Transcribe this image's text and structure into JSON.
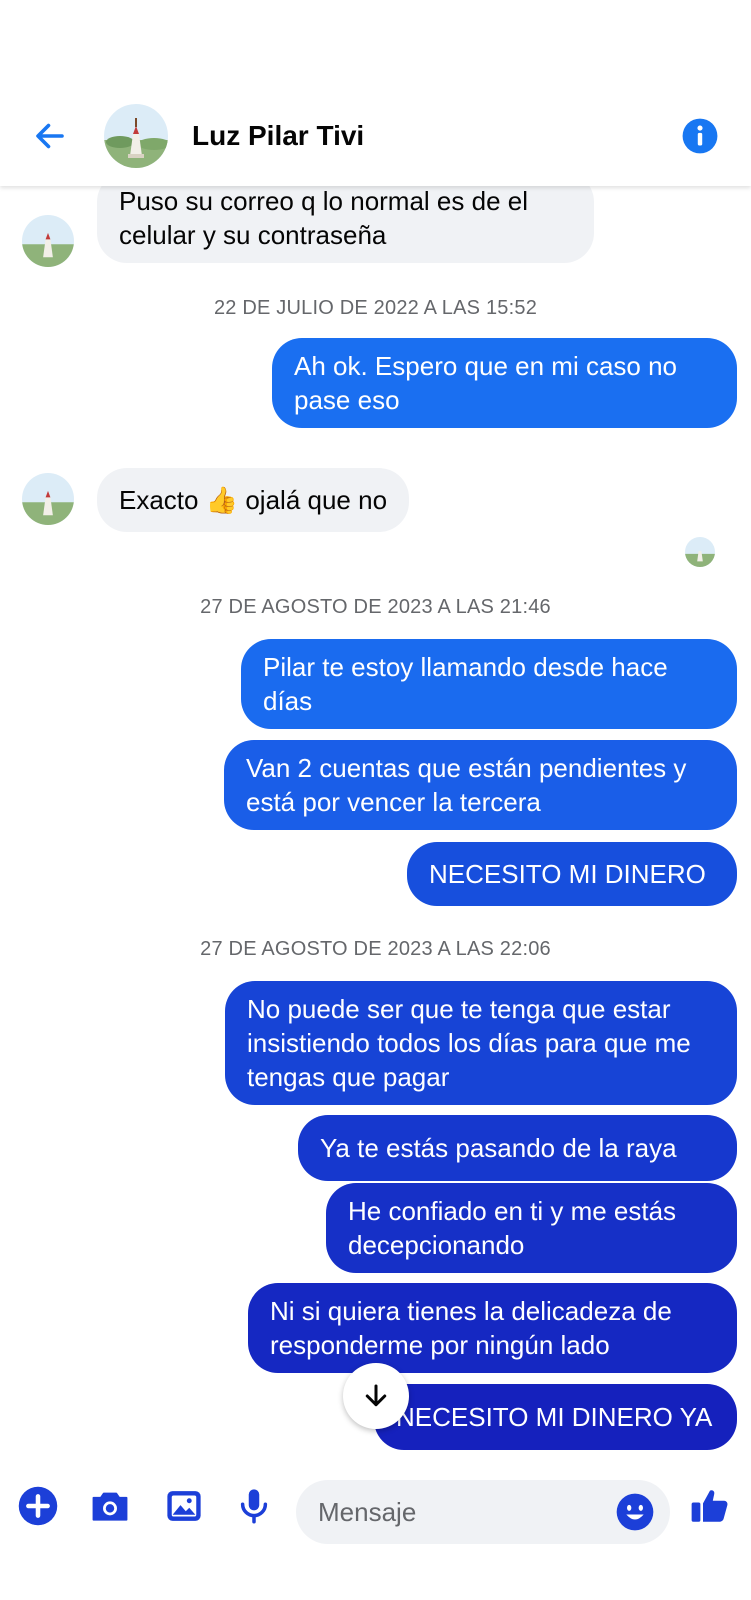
{
  "header": {
    "contact_name": "Luz Pilar Tivi",
    "back_icon": "arrow-left-icon",
    "info_icon": "info-icon"
  },
  "messages": {
    "m1": "Puso su correo q lo normal es de el celular y su contraseña",
    "ts1": "22 DE JULIO DE 2022 A LAS 15:52",
    "m2": "Ah ok. Espero que en mi caso no pase eso",
    "m3_pre": "Exacto",
    "m3_emoji": "👍",
    "m3_post": "ojalá que no",
    "ts2": "27 DE AGOSTO DE 2023 A LAS 21:46",
    "m4": "Pilar te estoy llamando desde hace días",
    "m5": "Van 2 cuentas que están pendientes y está por vencer la tercera",
    "m6": "NECESITO MI DINERO",
    "ts3": "27 DE AGOSTO DE 2023 A LAS 22:06",
    "m7": "No puede ser que te tenga que estar insistiendo todos los días para que me tengas que pagar",
    "m8": "Ya te estás pasando de la raya",
    "m9": "He confiado en ti y me estás decepcionando",
    "m10": "Ni si quiera tienes la delicadeza de responderme por ningún lado",
    "m11": "NECESITO MI DINERO YA"
  },
  "composer": {
    "placeholder": "Mensaje",
    "icons": [
      "plus-icon",
      "camera-icon",
      "image-icon",
      "microphone-icon",
      "emoji-icon",
      "thumbs-up-icon"
    ]
  },
  "colors": {
    "accent": "#1877f2",
    "outgoing_light": "#1b6ef0",
    "outgoing_dark": "#1521bd",
    "incoming_bg": "#f0f2f5",
    "timestamp": "#65676b"
  }
}
